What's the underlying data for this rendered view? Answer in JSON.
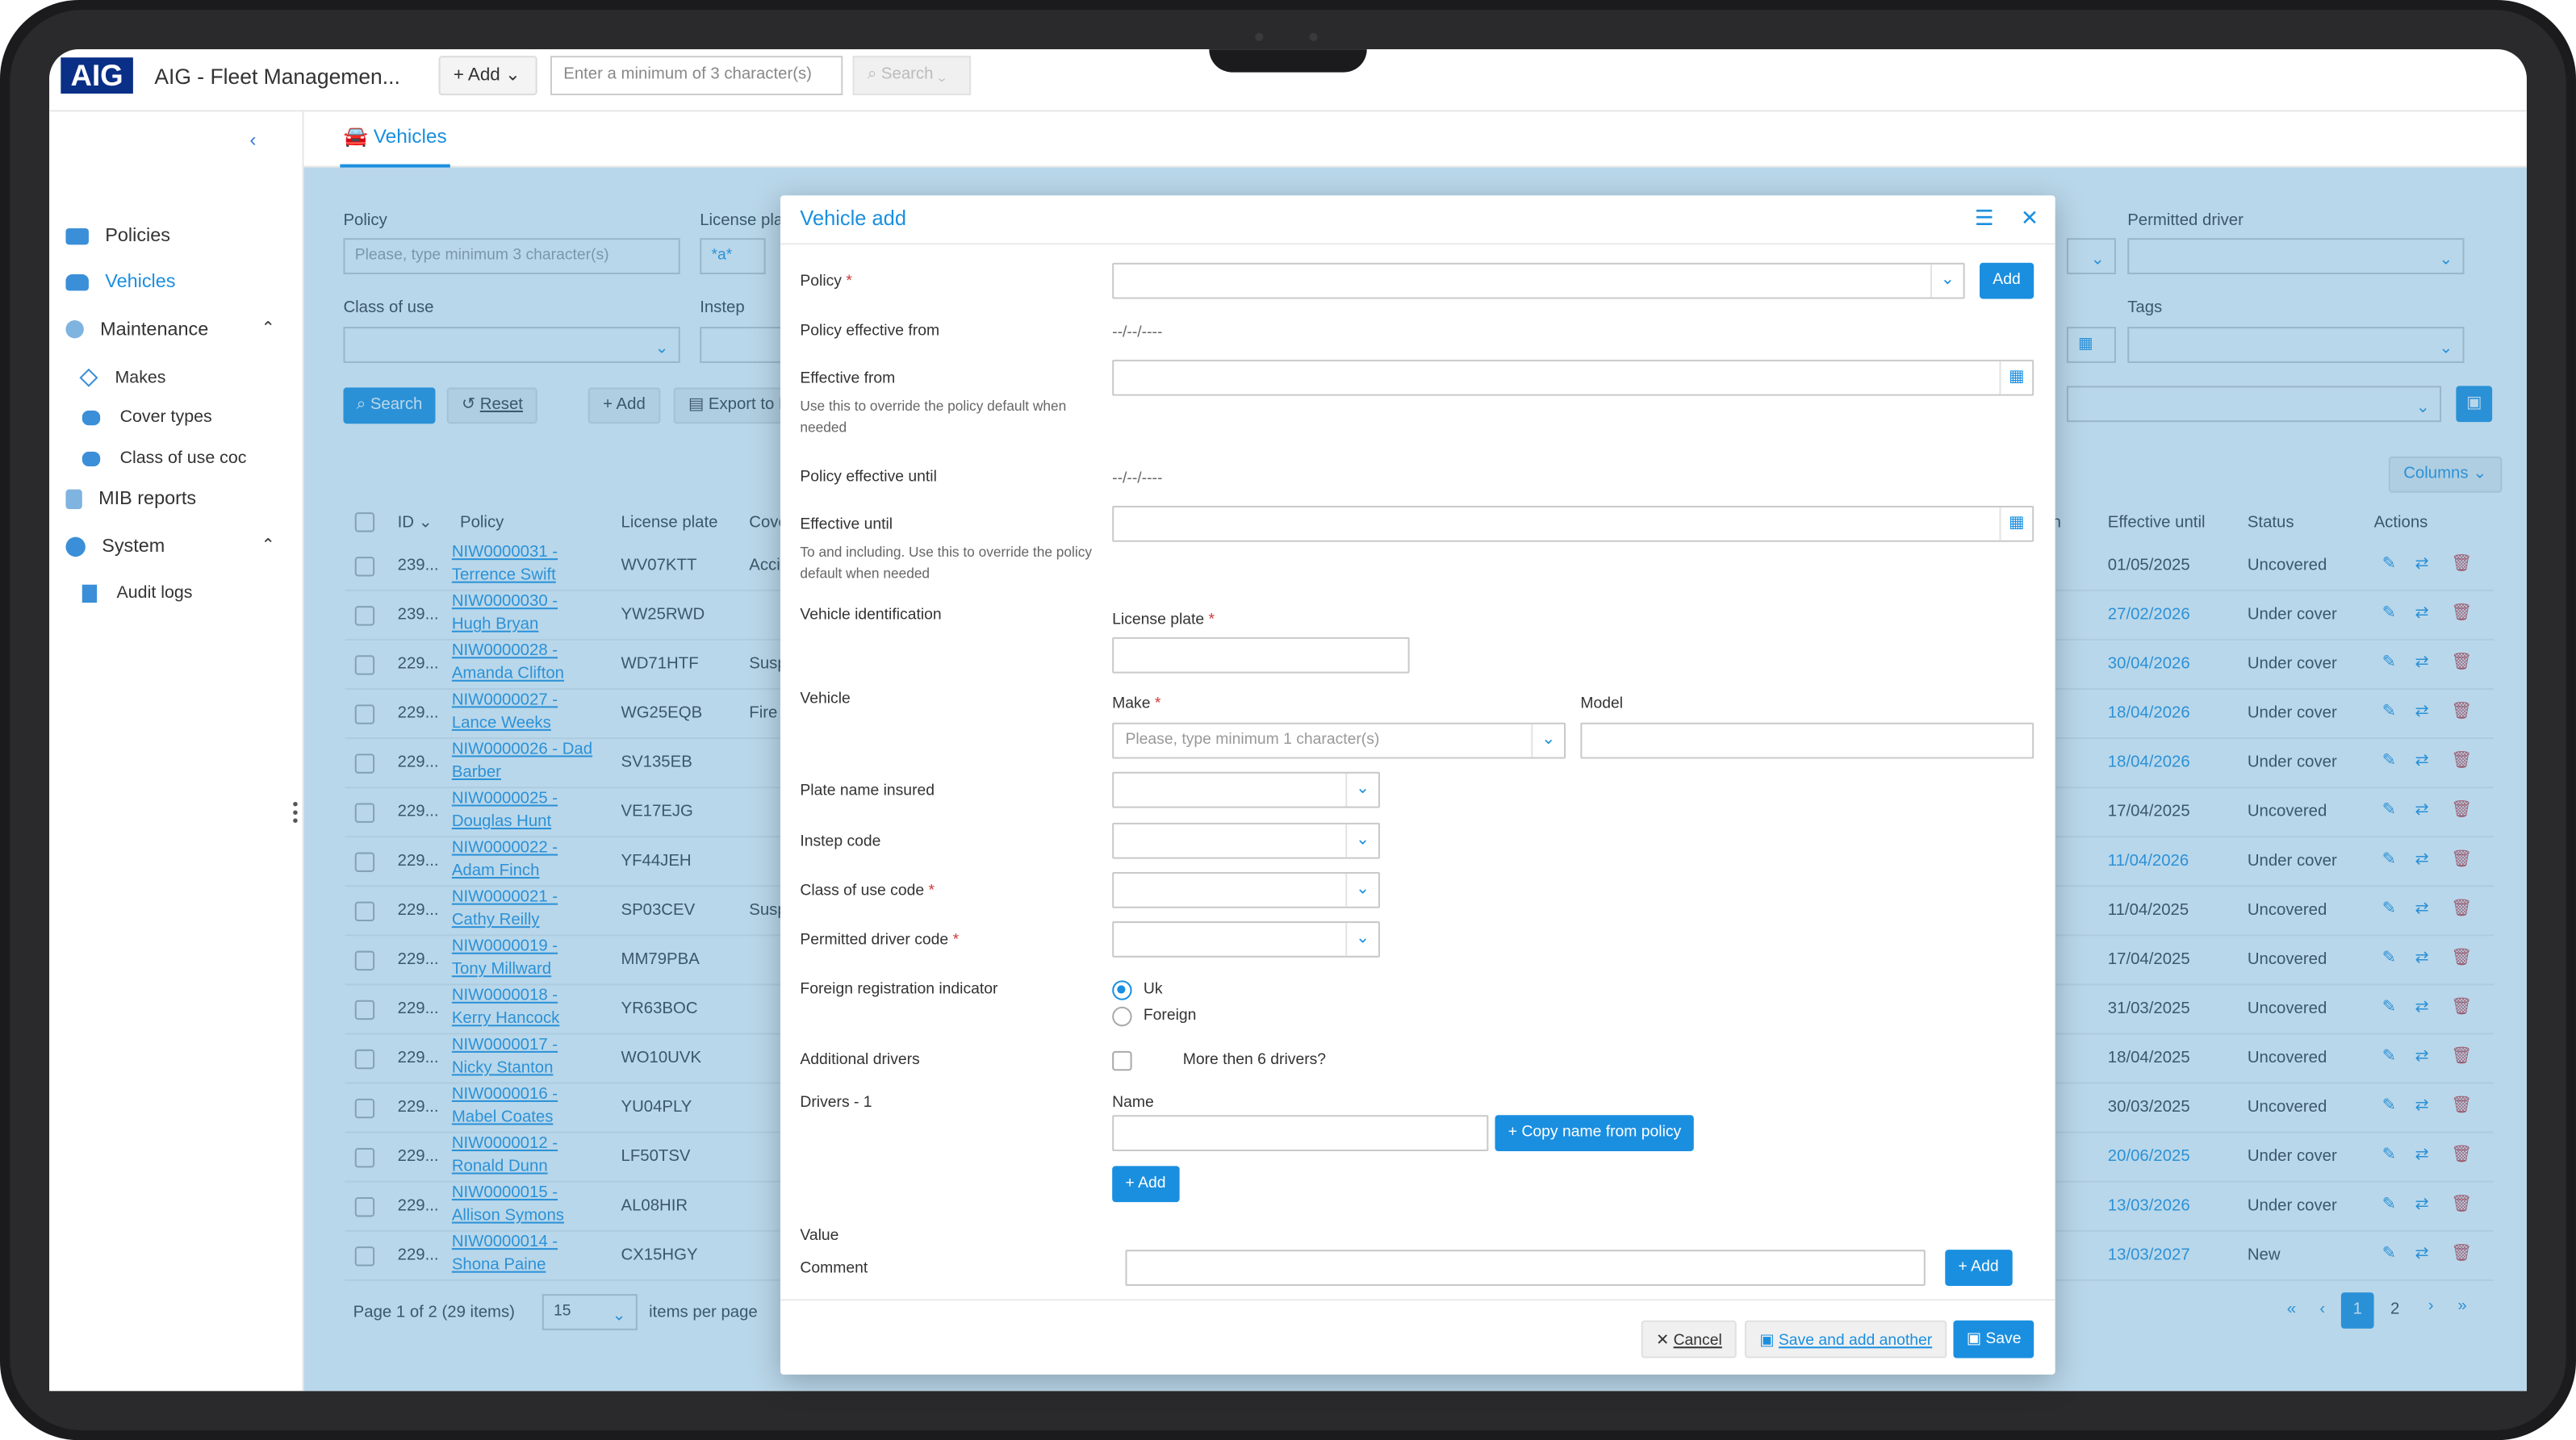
{
  "app": {
    "logo": "AIG",
    "title": "AIG - Fleet Managemen...",
    "add_label": "+ Add",
    "search_placeholder": "Enter a minimum of 3 character(s)",
    "search_label": "Search"
  },
  "sidebar": {
    "items": [
      {
        "label": "Policies"
      },
      {
        "label": "Vehicles"
      },
      {
        "label": "Maintenance"
      },
      {
        "label": "Makes"
      },
      {
        "label": "Cover types"
      },
      {
        "label": "Class of use coc"
      },
      {
        "label": "MIB reports"
      },
      {
        "label": "System"
      },
      {
        "label": "Audit logs"
      }
    ]
  },
  "tab": {
    "label": "Vehicles"
  },
  "filters": {
    "policy_label": "Policy",
    "policy_placeholder": "Please, type minimum 3 character(s)",
    "license_label": "License plat",
    "license_value": "*a*",
    "class_label": "Class of use",
    "instep_label": "Instep",
    "permitted_label": "Permitted driver",
    "tags_label": "Tags",
    "search_btn": "Search",
    "reset_btn": "Reset",
    "add_btn": "Add",
    "export_btn": "Export to E",
    "columns_btn": "Columns"
  },
  "table": {
    "headers": {
      "id": "ID",
      "policy": "Policy",
      "plate": "License plate",
      "cover": "Cove",
      "n": "n",
      "until": "Effective until",
      "status": "Status",
      "actions": "Actions"
    },
    "rows": [
      {
        "id": "239...",
        "policy1": "NIW0000031 -",
        "policy2": "Terrence Swift",
        "plate": "WV07KTT",
        "cover": "Acci",
        "until": "01/05/2025",
        "status": "Uncovered"
      },
      {
        "id": "239...",
        "policy1": "NIW0000030 -",
        "policy2": "Hugh Bryan",
        "plate": "YW25RWD",
        "cover": "",
        "until": "27/02/2026",
        "status": "Under cover"
      },
      {
        "id": "229...",
        "policy1": "NIW0000028 -",
        "policy2": "Amanda Clifton",
        "plate": "WD71HTF",
        "cover": "Susp",
        "until": "30/04/2026",
        "status": "Under cover"
      },
      {
        "id": "229...",
        "policy1": "NIW0000027 -",
        "policy2": "Lance Weeks",
        "plate": "WG25EQB",
        "cover": "Fire",
        "until": "18/04/2026",
        "status": "Under cover"
      },
      {
        "id": "229...",
        "policy1": "NIW0000026 - Dad",
        "policy2": "Barber",
        "plate": "SV135EB",
        "cover": "",
        "until": "18/04/2026",
        "status": "Under cover"
      },
      {
        "id": "229...",
        "policy1": "NIW0000025 -",
        "policy2": "Douglas Hunt",
        "plate": "VE17EJG",
        "cover": "",
        "until": "17/04/2025",
        "status": "Uncovered"
      },
      {
        "id": "229...",
        "policy1": "NIW0000022 -",
        "policy2": "Adam Finch",
        "plate": "YF44JEH",
        "cover": "",
        "until": "11/04/2026",
        "status": "Under cover"
      },
      {
        "id": "229...",
        "policy1": "NIW0000021 -",
        "policy2": "Cathy Reilly",
        "plate": "SP03CEV",
        "cover": "Susp",
        "until": "11/04/2025",
        "status": "Uncovered"
      },
      {
        "id": "229...",
        "policy1": "NIW0000019 -",
        "policy2": "Tony Millward",
        "plate": "MM79PBA",
        "cover": "",
        "until": "17/04/2025",
        "status": "Uncovered"
      },
      {
        "id": "229...",
        "policy1": "NIW0000018 -",
        "policy2": "Kerry Hancock",
        "plate": "YR63BOC",
        "cover": "",
        "until": "31/03/2025",
        "status": "Uncovered"
      },
      {
        "id": "229...",
        "policy1": "NIW0000017 -",
        "policy2": "Nicky Stanton",
        "plate": "WO10UVK",
        "cover": "",
        "until": "18/04/2025",
        "status": "Uncovered"
      },
      {
        "id": "229...",
        "policy1": "NIW0000016 -",
        "policy2": "Mabel Coates",
        "plate": "YU04PLY",
        "cover": "",
        "until": "30/03/2025",
        "status": "Uncovered"
      },
      {
        "id": "229...",
        "policy1": "NIW0000012 -",
        "policy2": "Ronald Dunn",
        "plate": "LF50TSV",
        "cover": "",
        "until": "20/06/2025",
        "status": "Under cover"
      },
      {
        "id": "229...",
        "policy1": "NIW0000015 -",
        "policy2": "Allison Symons",
        "plate": "AL08HIR",
        "cover": "",
        "until": "13/03/2026",
        "status": "Under cover"
      },
      {
        "id": "229...",
        "policy1": "NIW0000014 -",
        "policy2": "Shona Paine",
        "plate": "CX15HGY",
        "cover": "",
        "until": "13/03/2027",
        "status": "New"
      }
    ]
  },
  "pager": {
    "summary": "Page 1 of 2 (29 items)",
    "page_size": "15",
    "per_page": "items per page",
    "page1": "1",
    "page2": "2"
  },
  "modal": {
    "title": "Vehicle add",
    "policy_label": "Policy",
    "policy_add": "Add",
    "pef_label": "Policy effective from",
    "pef_value": "--/--/----",
    "ef_label": "Effective from",
    "ef_hint": "Use this to override the policy default when needed",
    "peu_label": "Policy effective until",
    "peu_value": "--/--/----",
    "eu_label": "Effective until",
    "eu_hint": "To and including. Use this to override the policy default when needed",
    "vid_label": "Vehicle identification",
    "plate_label": "License plate",
    "vehicle_label": "Vehicle",
    "make_label": "Make",
    "make_placeholder": "Please, type minimum 1 character(s)",
    "model_label": "Model",
    "plate_name_label": "Plate name insured",
    "instep_label": "Instep code",
    "class_label": "Class of use code",
    "permitted_label": "Permitted driver code",
    "foreign_label": "Foreign registration indicator",
    "opt_uk": "Uk",
    "opt_foreign": "Foreign",
    "addl_label": "Additional drivers",
    "more_drivers": "More then 6 drivers?",
    "drivers_label": "Drivers - 1",
    "name_label": "Name",
    "copy_btn": "Copy name from policy",
    "add_driver_btn": "Add",
    "value_label": "Value",
    "comment_label": "Comment",
    "comment_add": "Add",
    "cancel_btn": "Cancel",
    "save_another_btn": "Save and add another",
    "save_btn": "Save"
  }
}
